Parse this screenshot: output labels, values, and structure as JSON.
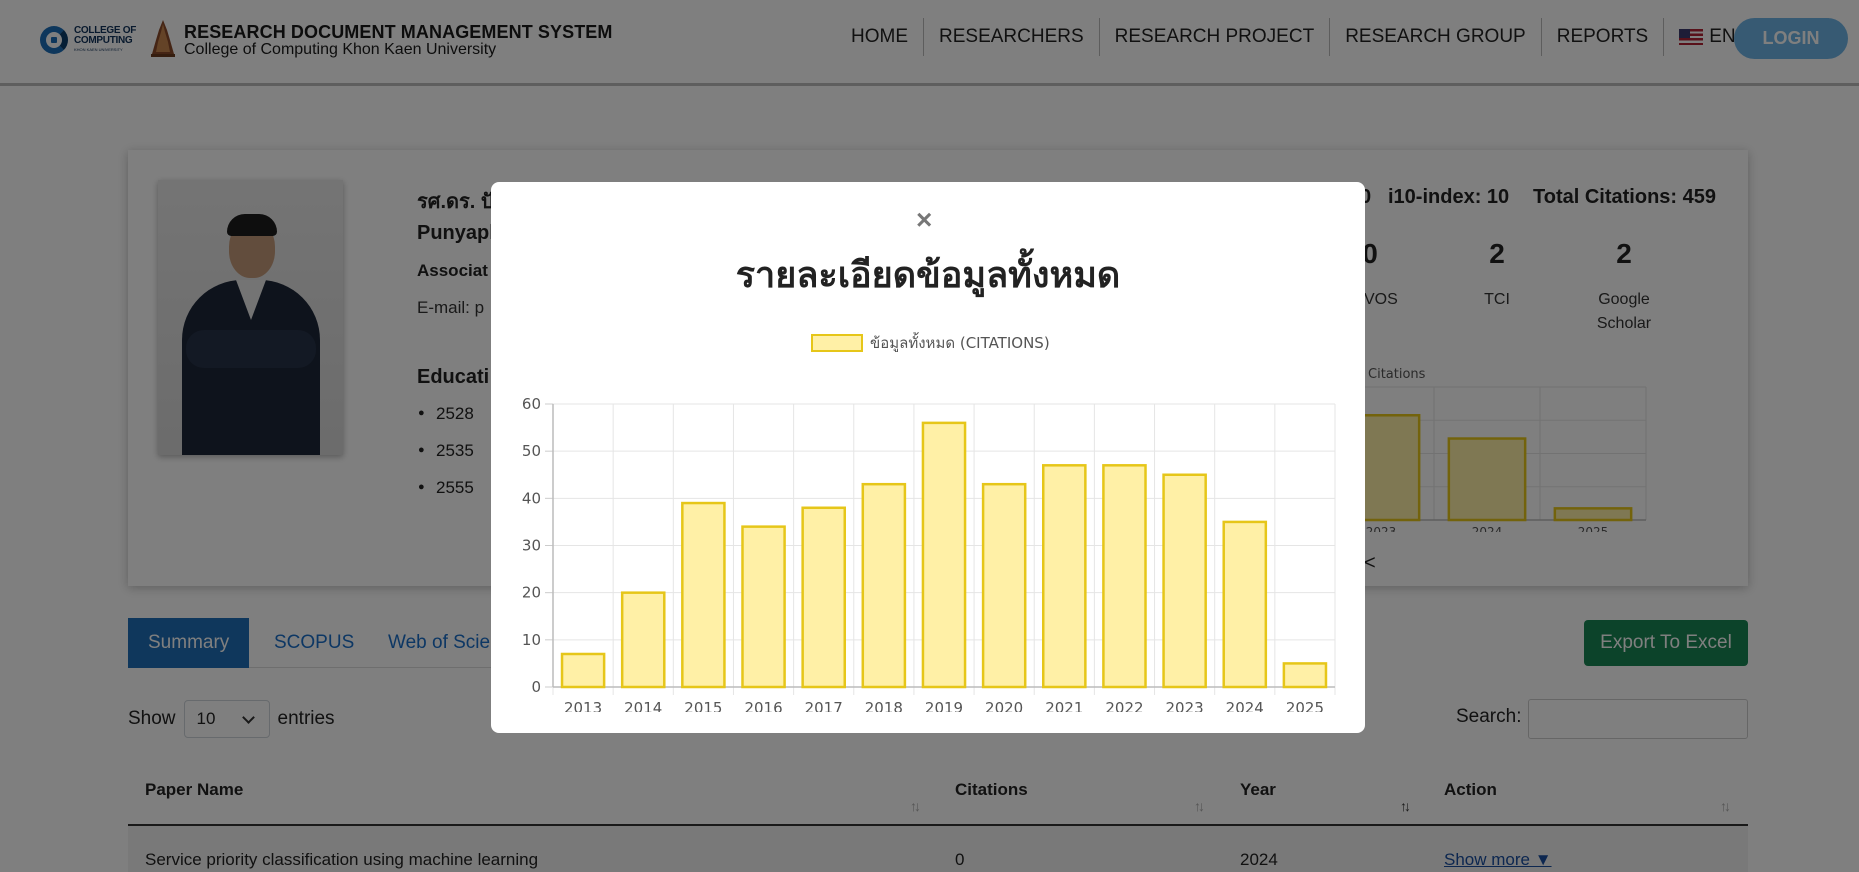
{
  "header": {
    "logo_line1": "COLLEGE OF",
    "logo_line2": "COMPUTING",
    "logo_line3": "KHON KAEN UNIVERSITY",
    "title": "RESEARCH DOCUMENT MANAGEMENT SYSTEM",
    "subtitle": "College of Computing Khon Kaen University",
    "nav": [
      "HOME",
      "RESEARCHERS",
      "RESEARCH PROJECT",
      "RESEARCH GROUP",
      "REPORTS"
    ],
    "language": "ENGLISH",
    "login": "LOGIN"
  },
  "profile": {
    "name_th": "รศ.ดร. ปั",
    "name_en": "Punyapl",
    "position": "Associat",
    "email": "E-mail:  p",
    "education_title": "Educati",
    "education": [
      "2528",
      "2535",
      "2555"
    ],
    "h_index_tail": "0",
    "i10_index": "i10-index: 10",
    "total_citations": "Total Citations: 459",
    "stats": [
      {
        "value": "0",
        "label": "VOS"
      },
      {
        "value": "2",
        "label": "TCI"
      },
      {
        "value": "2",
        "label": "Google Scholar"
      }
    ],
    "mini_chart_legend": "Citations",
    "prev": "<"
  },
  "tabs": [
    "Summary",
    "SCOPUS",
    "Web of Scie"
  ],
  "export_label": "Export To Excel",
  "entries": {
    "show": "Show",
    "value": "10",
    "suffix": "entries"
  },
  "search_label": "Search:",
  "table": {
    "headers": [
      "Paper Name",
      "Citations",
      "Year",
      "Action"
    ],
    "sort_glyph": "↑↓",
    "row": {
      "paper": "Service priority classification using machine learning",
      "citations": "0",
      "year": "2024",
      "action": "Show more ▼"
    }
  },
  "modal": {
    "close": "×",
    "title": "รายละเอียดข้อมูลทั้งหมด"
  },
  "colors": {
    "bar_fill": "#fff0a6",
    "bar_stroke": "#e6c619",
    "primary": "#1f6fb8",
    "export": "#198754"
  },
  "chart_data": [
    {
      "type": "bar",
      "legend": "ข้อมูลทั้งหมด (CITATIONS)",
      "categories": [
        "2013",
        "2014",
        "2015",
        "2016",
        "2017",
        "2018",
        "2019",
        "2020",
        "2021",
        "2022",
        "2023",
        "2024",
        "2025"
      ],
      "values": [
        7,
        20,
        39,
        34,
        38,
        43,
        56,
        43,
        47,
        47,
        45,
        35,
        5
      ],
      "ylim": [
        0,
        60
      ],
      "yticks": [
        0,
        10,
        20,
        30,
        40,
        50,
        60
      ],
      "grid": true,
      "legend_position": "top"
    },
    {
      "type": "bar",
      "legend": "Citations",
      "categories": [
        "2023",
        "2024",
        "2025"
      ],
      "values": [
        45,
        35,
        5
      ],
      "grid": true,
      "legend_position": "top"
    }
  ]
}
